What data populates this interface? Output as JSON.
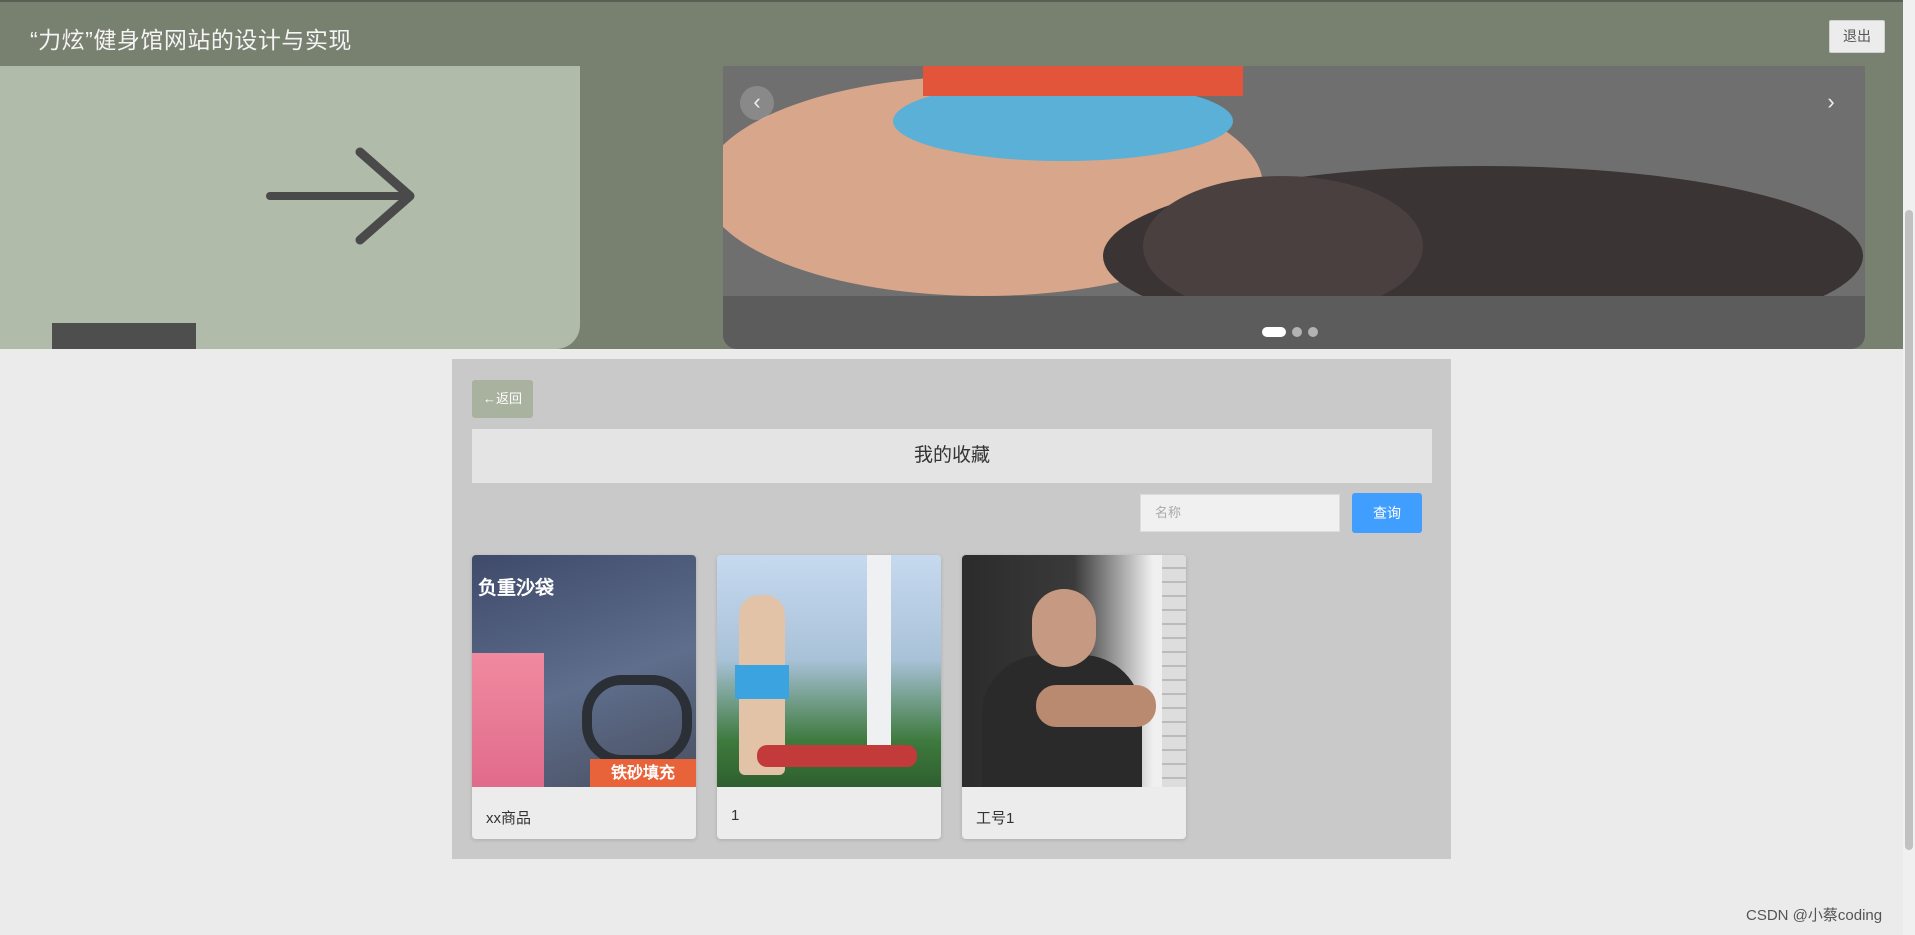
{
  "header": {
    "title": "“力炫”健身馆网站的设计与实现",
    "logout_label": "退出"
  },
  "banner": {
    "prev_icon": "‹",
    "next_icon": "›",
    "slide_count": 3,
    "active_slide": 1
  },
  "panel": {
    "back_label": "←返回",
    "title": "我的收藏",
    "search": {
      "placeholder": "名称",
      "value": ""
    },
    "search_button_label": "查询"
  },
  "cards": [
    {
      "name": "xx商品",
      "image_tag": "负重沙袋",
      "image_bottom_text": "铁砂填充",
      "image_icon": "product-image"
    },
    {
      "name": "1",
      "image_icon": "trainer-image"
    },
    {
      "name": "工号1",
      "image_icon": "coach-image"
    }
  ],
  "watermark": "CSDN @小蔡coding",
  "colors": {
    "header_bg": "#788070",
    "accent_blue": "#409eff",
    "back_btn": "#a9b29f"
  }
}
